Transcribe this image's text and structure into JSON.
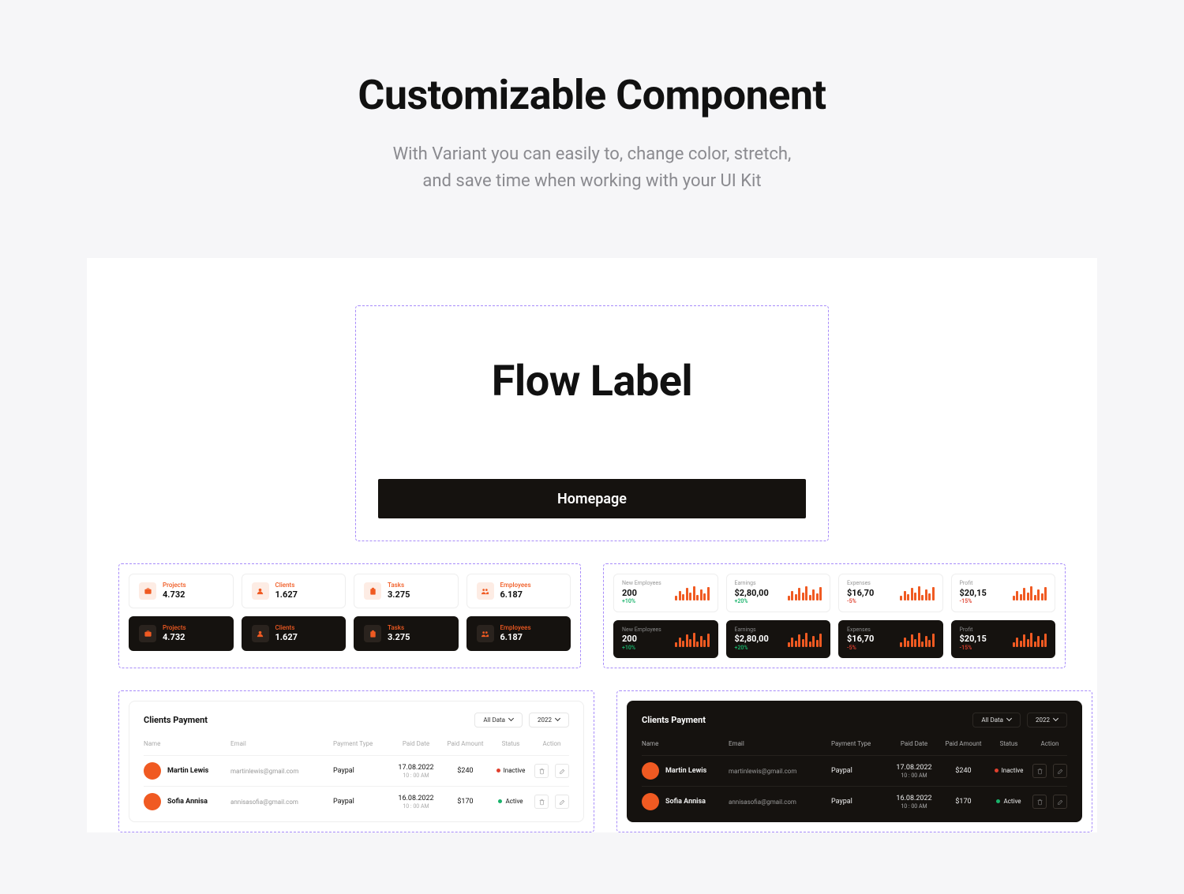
{
  "hero": {
    "title": "Customizable Component",
    "subtitle_l1": "With Variant you can easily to, change color, stretch,",
    "subtitle_l2": "and save time when working with your UI Kit"
  },
  "flow": {
    "title": "Flow Label",
    "button": "Homepage"
  },
  "stats": [
    {
      "label": "Projects",
      "value": "4.732",
      "icon": "briefcase"
    },
    {
      "label": "Clients",
      "value": "1.627",
      "icon": "users"
    },
    {
      "label": "Tasks",
      "value": "3.275",
      "icon": "clipboard"
    },
    {
      "label": "Employees",
      "value": "6.187",
      "icon": "people"
    }
  ],
  "metrics": [
    {
      "label": "New Employees",
      "value": "200",
      "change": "+10%",
      "dir": "up"
    },
    {
      "label": "Earnings",
      "value": "$2,80,00",
      "change": "+20%",
      "dir": "up"
    },
    {
      "label": "Expenses",
      "value": "$16,70",
      "change": "-5%",
      "dir": "down"
    },
    {
      "label": "Profit",
      "value": "$20,15",
      "change": "-15%",
      "dir": "down"
    }
  ],
  "spark_bars": [
    6,
    12,
    8,
    16,
    10,
    18,
    7,
    14,
    9,
    17
  ],
  "table": {
    "title": "Clients Payment",
    "filter_data": "All Data",
    "filter_year": "2022",
    "cols": {
      "name": "Name",
      "email": "Email",
      "type": "Payment Type",
      "date": "Paid Date",
      "amount": "Paid Amount",
      "status": "Status",
      "action": "Action"
    },
    "rows": [
      {
        "name": "Martin Lewis",
        "email": "martinlewis@gmail.com",
        "type": "Paypal",
        "date": "17.08.2022",
        "time": "10 : 00 AM",
        "amount": "$240",
        "status": "Inactive",
        "status_color": "red"
      },
      {
        "name": "Sofia Annisa",
        "email": "annisasofia@gmail.com",
        "type": "Paypal",
        "date": "16.08.2022",
        "time": "10 : 00 AM",
        "amount": "$170",
        "status": "Active",
        "status_color": "green"
      }
    ]
  },
  "colors": {
    "accent": "#f05a22",
    "dark": "#15120f"
  }
}
